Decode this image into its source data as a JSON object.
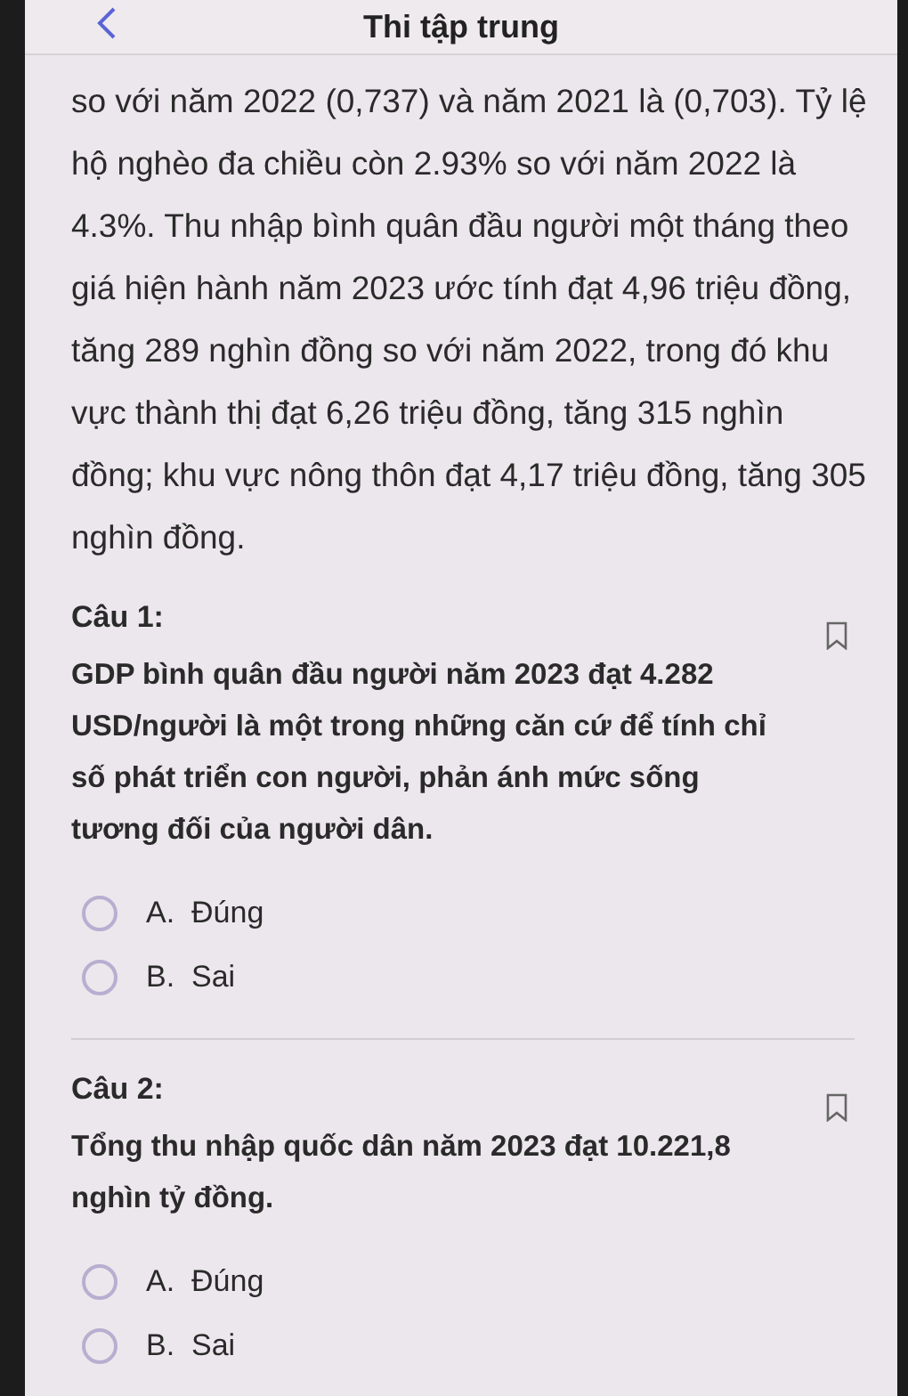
{
  "header": {
    "title": "Thi tập trung"
  },
  "passage": "so với năm 2022 (0,737) và năm 2021 là (0,703). Tỷ lệ hộ nghèo đa chiều còn 2.93% so với năm 2022 là 4.3%. Thu nhập bình quân đầu người một tháng theo giá hiện hành năm 2023 ước tính đạt 4,96 triệu đồng, tăng 289 nghìn đồng so với năm 2022, trong đó khu vực thành thị đạt 6,26 triệu đồng, tăng 315 nghìn đồng; khu vực nông thôn đạt 4,17 triệu đồng, tăng 305 nghìn đồng.",
  "questions": [
    {
      "label": "Câu 1:",
      "text": "GDP bình quân đầu người năm 2023 đạt 4.282 USD/người là một trong những căn cứ để tính chỉ số phát triển con người, phản ánh mức sống tương đối của người dân.",
      "options": [
        {
          "letter": "A.",
          "text": "Đúng",
          "selected": false
        },
        {
          "letter": "B.",
          "text": "Sai",
          "selected": false
        }
      ]
    },
    {
      "label": "Câu 2:",
      "text": "Tổng thu nhập quốc dân năm 2023 đạt 10.221,8 nghìn tỷ đồng.",
      "options": [
        {
          "letter": "A.",
          "text": "Đúng",
          "selected": false
        },
        {
          "letter": "B.",
          "text": "Sai",
          "selected": false
        }
      ]
    }
  ]
}
